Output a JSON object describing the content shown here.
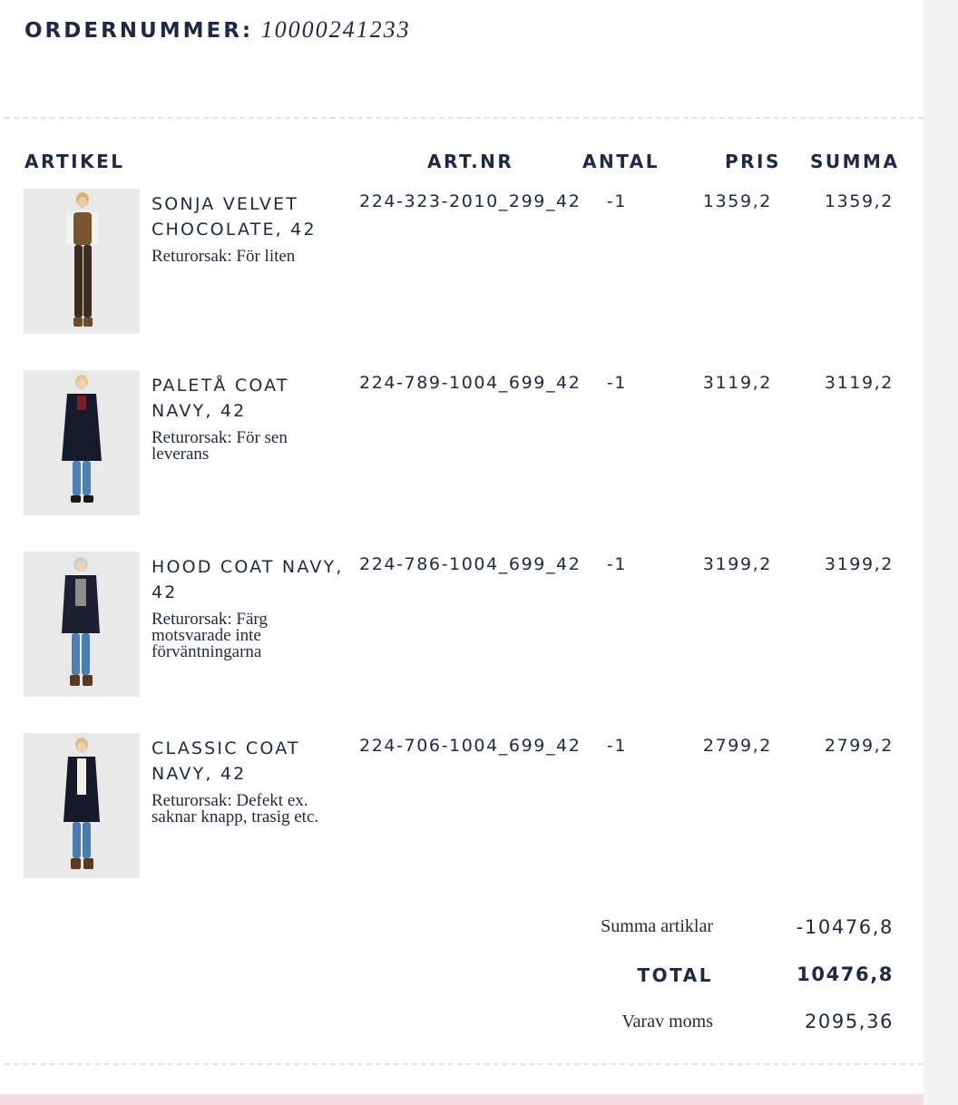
{
  "colors": {
    "text": "#1e2a44",
    "divider": "#dfe2e6",
    "thumb_bg": "#e9e9ea",
    "footer_band": "#f6dde2",
    "side_bg": "#f3f3f4"
  },
  "order": {
    "label": "ORDERNUMMER:",
    "number": "10000241233"
  },
  "columns": {
    "article": "ARTIKEL",
    "art_nr": "ART.NR",
    "quantity": "ANTAL",
    "price": "PRIS",
    "sum": "SUMMA"
  },
  "items": [
    {
      "name": "SONJA VELVET CHOCOLATE, 42",
      "reason": "Returorsak: För liten",
      "art_nr": "224-323-2010_299_42",
      "quantity": "-1",
      "price": "1359,2",
      "sum": "1359,2",
      "image_icon": "model-brown-vest-photo"
    },
    {
      "name": "PALETÅ COAT NAVY, 42",
      "reason": "Returorsak: För sen leverans",
      "art_nr": "224-789-1004_699_42",
      "quantity": "-1",
      "price": "3119,2",
      "sum": "3119,2",
      "image_icon": "model-navy-coat-photo"
    },
    {
      "name": "HOOD COAT NAVY, 42",
      "reason": "Returorsak: Färg motsvarade inte förväntningarna",
      "art_nr": "224-786-1004_699_42",
      "quantity": "-1",
      "price": "3199,2",
      "sum": "3199,2",
      "image_icon": "model-hood-coat-photo"
    },
    {
      "name": "CLASSIC COAT NAVY, 42",
      "reason": "Returorsak: Defekt ex. saknar knapp, trasig etc.",
      "art_nr": "224-706-1004_699_42",
      "quantity": "-1",
      "price": "2799,2",
      "sum": "2799,2",
      "image_icon": "model-classic-coat-photo"
    }
  ],
  "totals": {
    "subtotal_label": "Summa artiklar",
    "subtotal_value": "-10476,8",
    "total_label": "TOTAL",
    "total_value": "10476,8",
    "vat_label": "Varav moms",
    "vat_value": "2095,36"
  }
}
